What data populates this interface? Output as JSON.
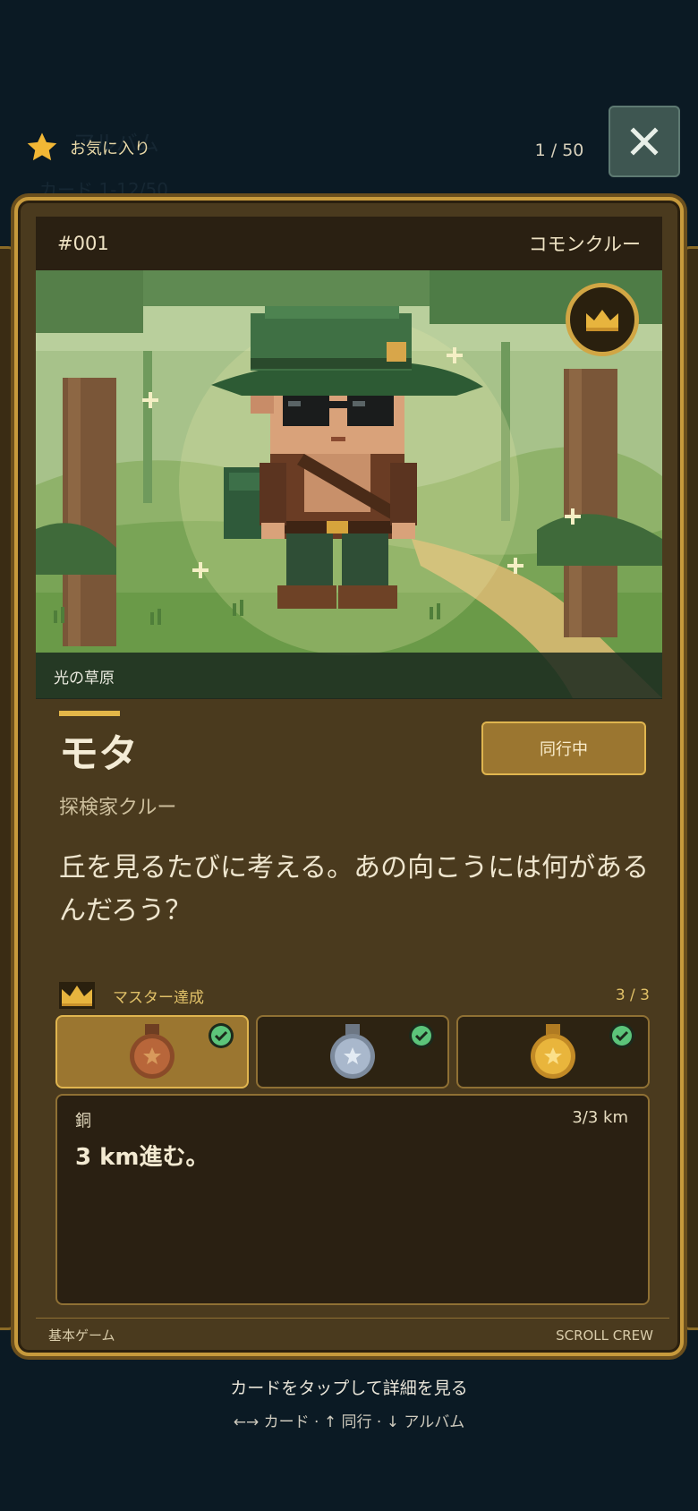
{
  "background_ghost": {
    "title": "アルバム",
    "subtitle": "カード 1-12/50"
  },
  "top_bar": {
    "favorite_label": "お気に入り",
    "counter": "1 / 50",
    "close_icon": "close-icon"
  },
  "card": {
    "number": "#001",
    "rarity": "コモンクルー",
    "location": "光の草原",
    "name": "モタ",
    "role": "探検家クルー",
    "status_button": "同行中",
    "description": "丘を見るたびに考える。あの向こうには何があるんだろう？",
    "mastery": {
      "label": "マスター達成",
      "count": "3 / 3",
      "medals": [
        {
          "tier": "bronze",
          "completed": true,
          "selected": true,
          "color": "#b8663a"
        },
        {
          "tier": "silver",
          "completed": true,
          "selected": false,
          "color": "#a9b8cc"
        },
        {
          "tier": "gold",
          "completed": true,
          "selected": false,
          "color": "#e9b53c"
        }
      ]
    },
    "task": {
      "tier_label": "銅",
      "progress": "3/3 km",
      "text": "3 km進む。"
    },
    "footer_left": "基本ゲーム",
    "footer_right": "SCROLL CREW"
  },
  "hints": {
    "line1": "カードをタップして詳細を見る",
    "line2": "←→ カード · ↑ 同行 · ↓ アルバム"
  },
  "colors": {
    "background": "#0b1a24",
    "card_border": "#c79a3c",
    "accent_gold": "#e0b54f",
    "check_green": "#5cc47a"
  }
}
